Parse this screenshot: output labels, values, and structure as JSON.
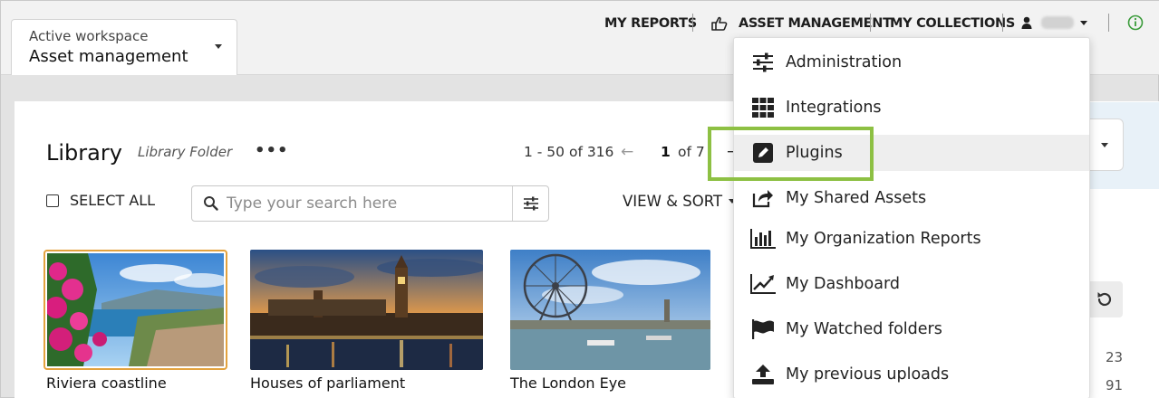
{
  "workspace": {
    "label": "Active workspace",
    "value": "Asset management"
  },
  "nav": {
    "my_reports": "MY REPORTS",
    "asset_management": "ASSET MANAGEMENT",
    "my_collections": "MY COLLECTIONS"
  },
  "library": {
    "title": "Library",
    "folder": "Library Folder",
    "more": "•••",
    "range": "1 - 50 of 316",
    "page": "1",
    "of_pages": "of 7",
    "select_all": "SELECT ALL",
    "view_sort": "VIEW & SORT"
  },
  "search": {
    "placeholder": "Type your search here",
    "value": ""
  },
  "assets": [
    {
      "caption": "Riviera coastline"
    },
    {
      "caption": "Houses of parliament"
    },
    {
      "caption": "The London Eye"
    }
  ],
  "right_fragments": [
    "23",
    "91"
  ],
  "menu": {
    "items": [
      {
        "label": "Administration",
        "icon": "sliders-icon"
      },
      {
        "label": "Integrations",
        "icon": "grid-icon"
      },
      {
        "label": "Plugins",
        "icon": "edit-icon"
      },
      {
        "label": "My Shared Assets",
        "icon": "share-icon"
      },
      {
        "label": "My Organization Reports",
        "icon": "bar-chart-icon"
      },
      {
        "label": "My Dashboard",
        "icon": "line-chart-icon"
      },
      {
        "label": "My Watched folders",
        "icon": "flag-icon"
      },
      {
        "label": "My previous uploads",
        "icon": "upload-icon"
      }
    ]
  },
  "colors": {
    "highlight": "#8dc043",
    "selected_border": "#e3a23e",
    "info_green": "#3a9b3a"
  }
}
